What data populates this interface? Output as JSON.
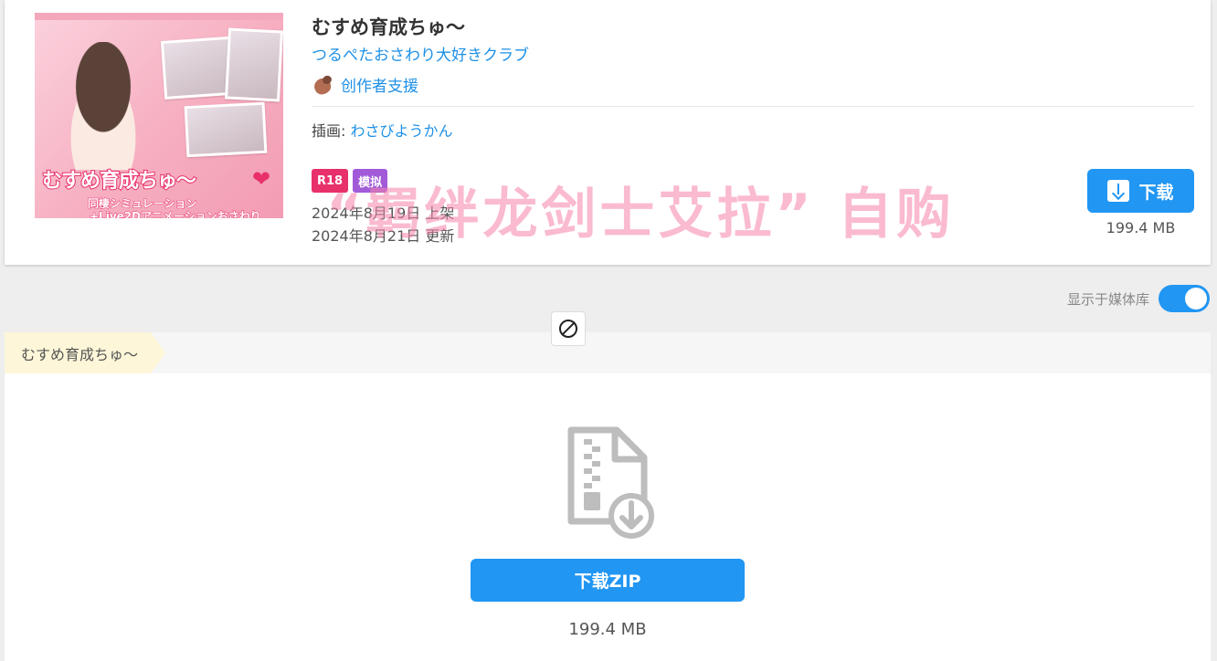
{
  "work": {
    "title": "むすめ育成ちゅ〜",
    "circle": "つるぺたおさわり大好きクラブ",
    "support_label": "创作者支援",
    "illustrator_label": "插画:",
    "illustrator_name": "わさびようかん",
    "badges": [
      "R18",
      "模拟"
    ],
    "release_date": "2024年8月19日 上架",
    "update_date": "2024年8月21日 更新",
    "download_label": "下载",
    "size": "199.4 MB"
  },
  "cover": {
    "title": "むすめ育成ちゅ〜",
    "subtitle1": "同棲シミュレーション",
    "subtitle2": "+Live2Dアニメーションおさわり"
  },
  "watermark": "“羁绊龙剑士艾拉” 自购",
  "media_toggle": {
    "label": "显示于媒体库",
    "on": true
  },
  "breadcrumb": {
    "item": "むすめ育成ちゅ〜"
  },
  "file_panel": {
    "icon": "zip-download-icon",
    "download_zip_label": "下载ZIP",
    "size": "199.4 MB"
  },
  "colors": {
    "accent": "#2196f3",
    "link": "#1e90e6",
    "r18": "#e8306b",
    "sim": "#a15bd9",
    "breadcrumb_bg": "#fdf6d8"
  }
}
